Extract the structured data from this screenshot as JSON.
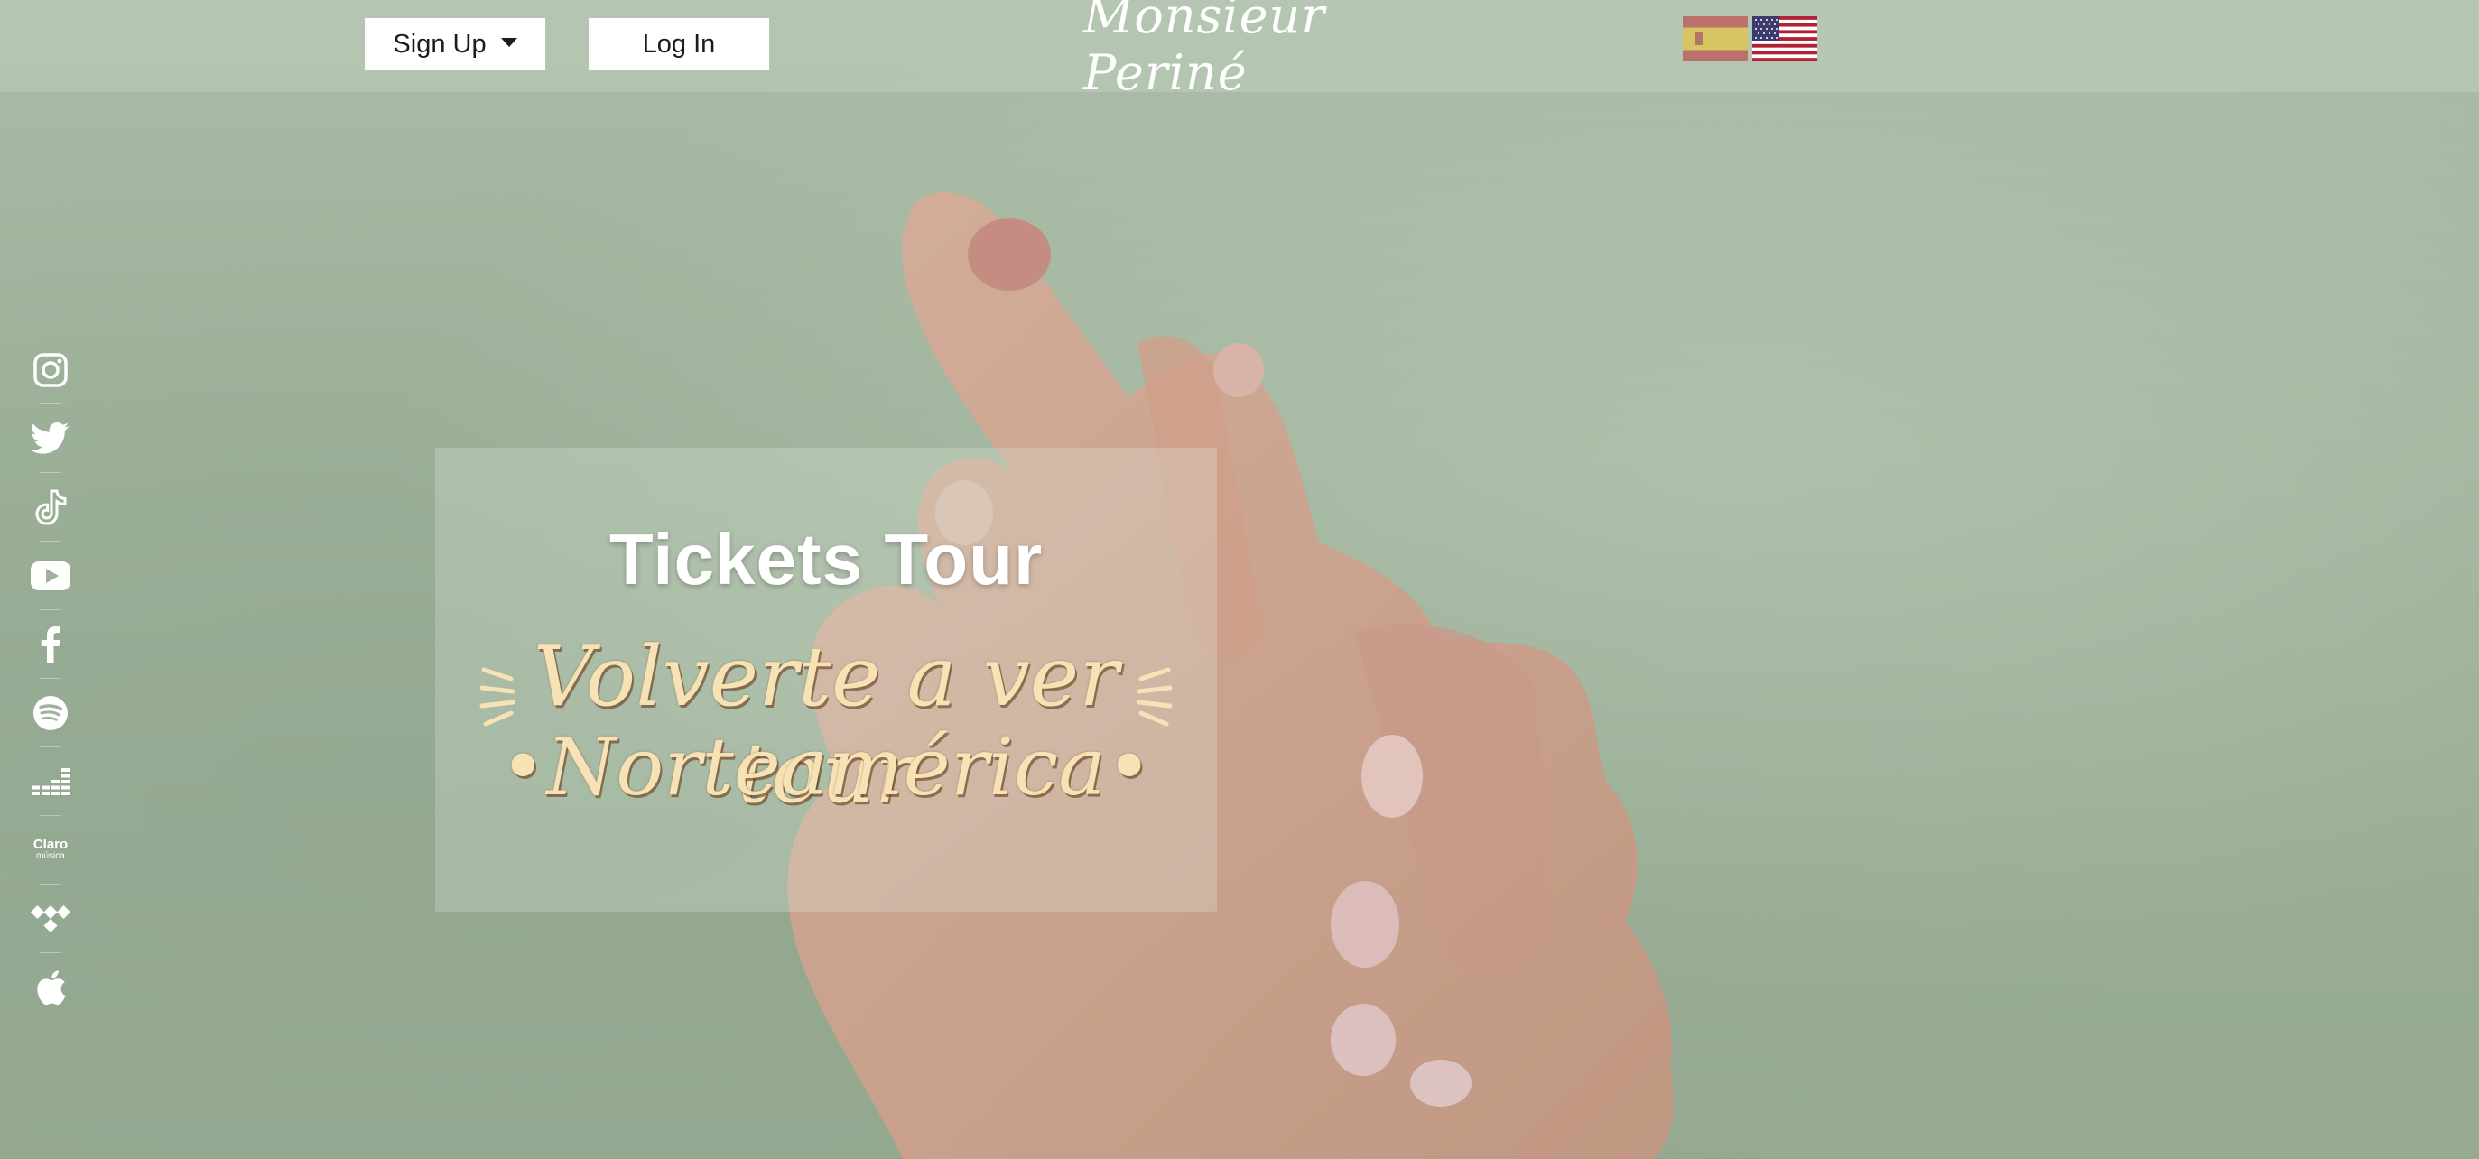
{
  "header": {
    "signup_label": "Sign Up",
    "login_label": "Log In",
    "brand": "Monsieur Periné",
    "languages": [
      "es",
      "en-US"
    ]
  },
  "social": {
    "items": [
      {
        "name": "instagram-icon"
      },
      {
        "name": "twitter-icon"
      },
      {
        "name": "tiktok-icon"
      },
      {
        "name": "youtube-icon"
      },
      {
        "name": "facebook-icon"
      },
      {
        "name": "spotify-icon"
      },
      {
        "name": "deezer-icon"
      },
      {
        "name": "claro-musica-icon",
        "text": "Claro",
        "subtext": "música"
      },
      {
        "name": "tidal-icon"
      },
      {
        "name": "apple-music-icon"
      }
    ]
  },
  "hero": {
    "title": "Tickets Tour",
    "tour_line_1": "Volverte a ver tour",
    "tour_line_2": "•Norteamérica•"
  },
  "colors": {
    "background": "#9eb29b",
    "tour_text": "#f6e2b4",
    "tour_shadow": "#6e4628"
  }
}
